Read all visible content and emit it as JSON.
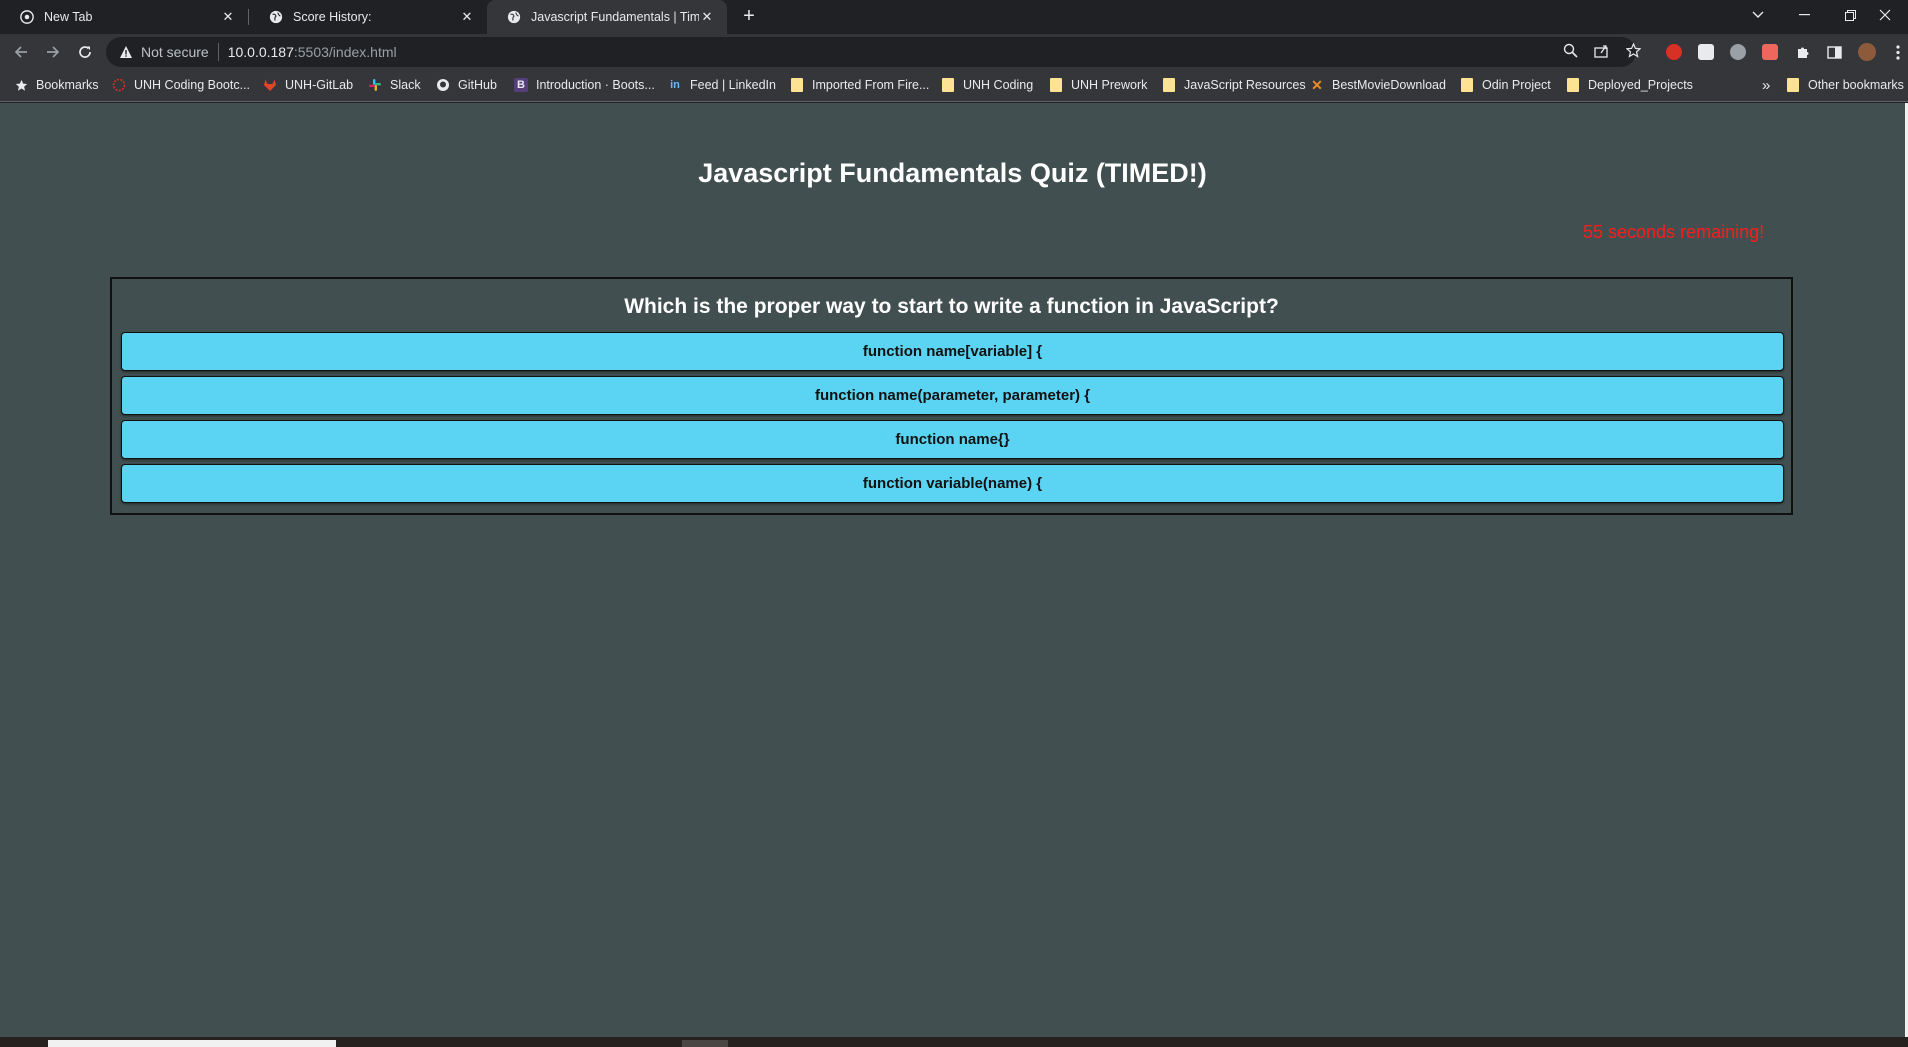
{
  "browser": {
    "tabs": [
      {
        "title": "New Tab",
        "active": false
      },
      {
        "title": "Score History:",
        "active": false
      },
      {
        "title": "Javascript Fundamentals | Timed",
        "active": true
      }
    ],
    "omnibox": {
      "security_label": "Not secure",
      "url_host": "10.0.0.187",
      "url_rest": ":5503/index.html"
    },
    "bookmarks": [
      {
        "label": "Bookmarks",
        "icon": "star-icon"
      },
      {
        "label": "UNH Coding Bootc...",
        "icon": "unh-icon"
      },
      {
        "label": "UNH-GitLab",
        "icon": "gitlab-icon"
      },
      {
        "label": "Slack",
        "icon": "slack-icon"
      },
      {
        "label": "GitHub",
        "icon": "github-icon"
      },
      {
        "label": "Introduction · Boots...",
        "icon": "bootstrap-icon"
      },
      {
        "label": "Feed | LinkedIn",
        "icon": "linkedin-icon"
      },
      {
        "label": "Imported From Fire...",
        "icon": "folder-icon"
      },
      {
        "label": "UNH Coding",
        "icon": "folder-icon"
      },
      {
        "label": "UNH Prework",
        "icon": "folder-icon"
      },
      {
        "label": "JavaScript Resources",
        "icon": "folder-icon"
      },
      {
        "label": "BestMovieDownload",
        "icon": "x-icon"
      },
      {
        "label": "Odin Project",
        "icon": "folder-icon"
      },
      {
        "label": "Deployed_Projects",
        "icon": "folder-icon"
      }
    ],
    "overflow_label": "»",
    "other_bookmarks": "Other bookmarks",
    "colors": {
      "tab_strip": "#202124",
      "toolbar": "#35363a"
    }
  },
  "quiz": {
    "title": "Javascript Fundamentals Quiz (TIMED!)",
    "timer_text": "55 seconds remaining!",
    "question": "Which is the proper way to start to write a function in JavaScript?",
    "answers": [
      "function name[variable] {",
      "function name(parameter, parameter) {",
      "function name{}",
      "function variable(name) {"
    ],
    "colors": {
      "background": "#424f50",
      "answer": "#5bd4f3",
      "timer": "#ff1a1a"
    }
  }
}
